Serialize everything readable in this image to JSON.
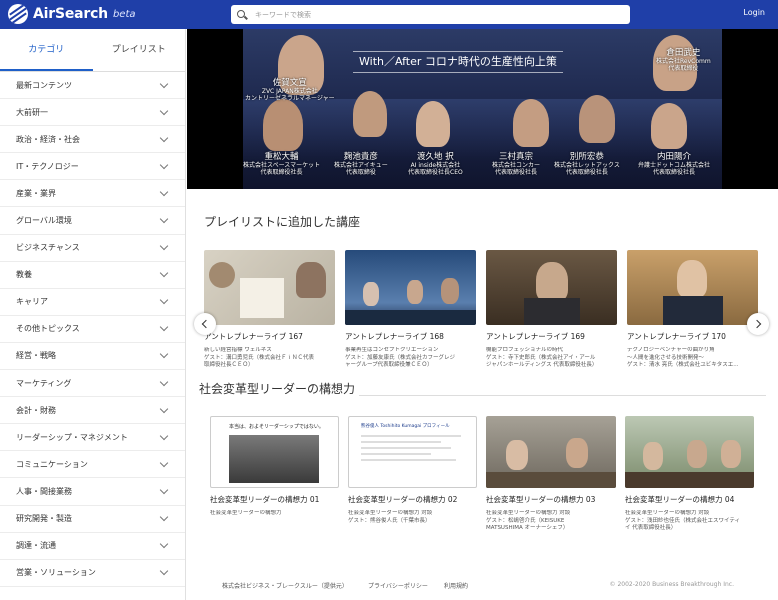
{
  "header": {
    "logo_text": "AirSearch",
    "logo_beta": "beta",
    "search_placeholder": "キーワードで検索",
    "login_label": "Login"
  },
  "sidebar": {
    "tabs": [
      "カテゴリ",
      "プレイリスト"
    ],
    "categories": [
      "最新コンテンツ",
      "大前研一",
      "政治・経済・社会",
      "IT・テクノロジー",
      "産業・業界",
      "グローバル環境",
      "ビジネスチャンス",
      "教養",
      "キャリア",
      "その他トピックス",
      "経営・戦略",
      "マーケティング",
      "会計・財務",
      "リーダーシップ・マネジメント",
      "コミュニケーション",
      "人事・間接業務",
      "研究開発・製造",
      "調達・流通",
      "営業・ソリューション"
    ]
  },
  "hero": {
    "title": "With／After コロナ時代の生産性向上策",
    "speakers": [
      {
        "name": "佐賀文宣",
        "org": "ZVC JAPAN株式会社\nカントリーゼネラルマネージャー"
      },
      {
        "name": "重松大輔",
        "org": "株式会社スペースマーケット\n代表取締役社長"
      },
      {
        "name": "麹池貴彦",
        "org": "株式会社アイキュー\n代表取締役"
      },
      {
        "name": "渡久地 択",
        "org": "AI inside株式会社\n代表取締役社長CEO"
      },
      {
        "name": "三村真宗",
        "org": "株式会社コンカー\n代表取締役社長"
      },
      {
        "name": "別所宏恭",
        "org": "株式会社レットアックス\n代表取締役社長"
      },
      {
        "name": "内田陽介",
        "org": "弁護士ドットコム株式会社\n代表取締役社長"
      },
      {
        "name": "倉田武史",
        "org": "株式会社RevComm\n代表取締役"
      }
    ]
  },
  "playlist_section": {
    "title": "プレイリストに追加した講座",
    "cards": [
      {
        "title": "アントレプレナーライブ 167",
        "desc": "新しい経営指標 ウェルネス\nゲスト：溝口勇児氏（株式会社ＦｉＮＣ代表\n取締役社長ＣＥＯ）"
      },
      {
        "title": "アントレプレナーライブ 168",
        "desc": "事業再生はコンセプトクリエーション\nゲスト：加藤友康氏（株式会社カフーグレジ\nャーグループ代表取締役兼ＣＥＯ）"
      },
      {
        "title": "アントレプレナーライブ 169",
        "desc": "機能プロフェッショナルの時代\nゲスト：寺下史郎氏（株式会社アイ・アール\nジャパンホールディングス 代表取締役社長）"
      },
      {
        "title": "アントレプレナーライブ 170",
        "desc": "テクノロジーベンチャーの曲がり角\n～人間を進化させる技術開発～\nゲスト：清水 亮氏（株式会社ユビキタスエ..."
      }
    ]
  },
  "series_section": {
    "title": "社会変革型リーダーの構想力",
    "slide1_text": "本当は、およそリーダーシップではない。",
    "slide2_text": "熊谷俊人 Toshihito Kumagai プロフィール",
    "cards": [
      {
        "title": "社会変革型リーダーの構想力 01",
        "desc": "社会変革型リーダーの構想力"
      },
      {
        "title": "社会変革型リーダーの構想力 02",
        "desc": "社会変革型リーダーの構想力 対談\nゲスト：熊谷俊人氏（千葉市長）"
      },
      {
        "title": "社会変革型リーダーの構想力 03",
        "desc": "社会変革型リーダーの構想力 対談\nゲスト：松嶋啓介氏（KEISUKE\nMATSUSHIMA オーナーシェフ）"
      },
      {
        "title": "社会変革型リーダーの構想力 04",
        "desc": "社会変革型リーダーの構想力 対談\nゲスト：浅田紗也佳氏（株式会社エスワイティ\nイ 代表取締役社長）"
      }
    ]
  },
  "footer": {
    "company": "株式会社ビジネス・ブレークスルー（提供元）",
    "privacy": "プライバシーポリシー",
    "terms": "利用規約",
    "copyright": "© 2002-2020 Business Breakthrough Inc."
  },
  "colors": {
    "header_bg": "#1f3fa8",
    "active_tab": "#1f5fc8"
  }
}
